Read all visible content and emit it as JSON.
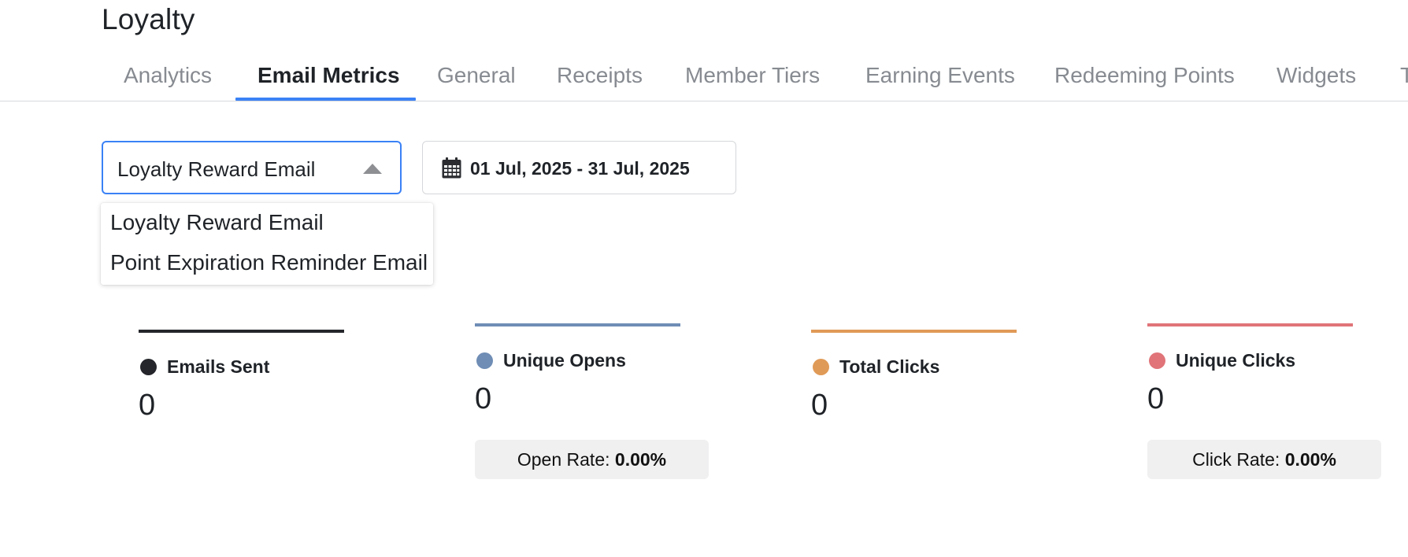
{
  "page": {
    "title": "Loyalty"
  },
  "tabs": [
    {
      "label": "Analytics",
      "active": false
    },
    {
      "label": "Email Metrics",
      "active": true
    },
    {
      "label": "General",
      "active": false
    },
    {
      "label": "Receipts",
      "active": false
    },
    {
      "label": "Member Tiers",
      "active": false
    },
    {
      "label": "Earning Events",
      "active": false
    },
    {
      "label": "Redeeming Points",
      "active": false
    },
    {
      "label": "Widgets",
      "active": false
    },
    {
      "label": "T",
      "active": false
    }
  ],
  "accent_color": "#3b82f6",
  "email_select": {
    "value": "Loyalty Reward Email",
    "expanded": true,
    "options": [
      "Loyalty Reward Email",
      "Point Expiration Reminder Email"
    ]
  },
  "date_range": {
    "icon": "calendar-icon",
    "value": "01 Jul, 2025 - 31 Jul, 2025"
  },
  "metrics": [
    {
      "label": "Emails Sent",
      "value": "0",
      "color": "#24262b"
    },
    {
      "label": "Unique Opens",
      "value": "0",
      "color": "#6f8db5",
      "rate_label": "Open Rate:",
      "rate_value": "0.00%"
    },
    {
      "label": "Total Clicks",
      "value": "0",
      "color": "#e09a57"
    },
    {
      "label": "Unique Clicks",
      "value": "0",
      "color": "#e07479",
      "rate_label": "Click Rate:",
      "rate_value": "0.00%"
    }
  ]
}
